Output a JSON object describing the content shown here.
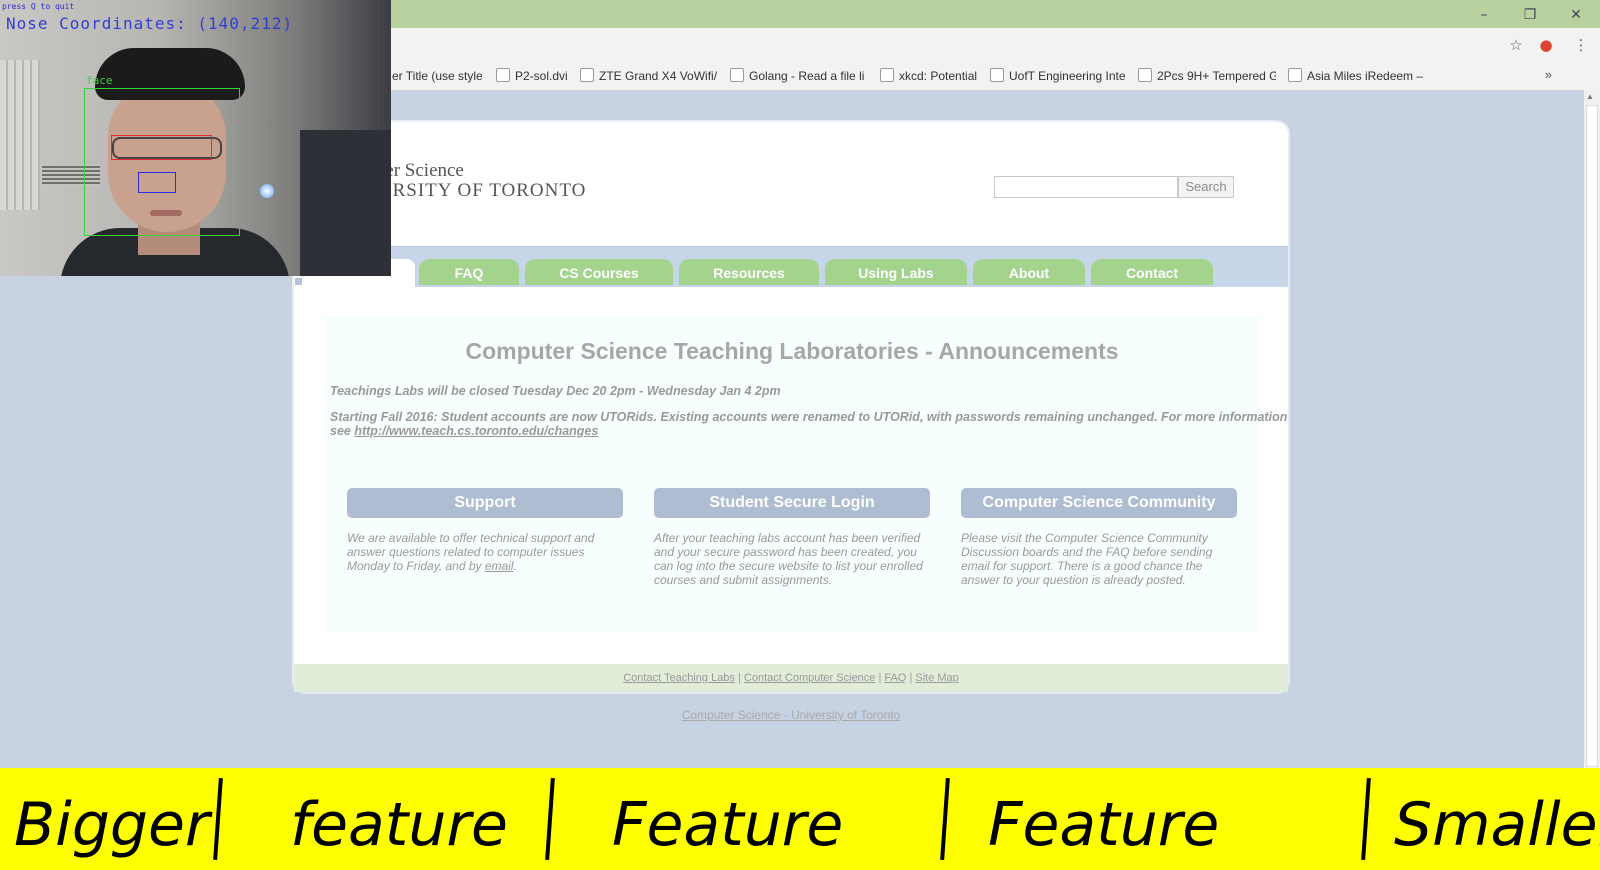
{
  "browser": {
    "window_controls": [
      "–",
      "❐",
      "✕"
    ],
    "toolbar_icons": [
      "star-icon",
      "extension-icon",
      "menu-icon"
    ],
    "bookmarks": [
      "er Title (use style:",
      "P2-sol.dvi",
      "ZTE Grand X4 VoWifi/",
      "Golang - Read a file li",
      "xkcd: Potential",
      "UofT Engineering Inte",
      "2Pcs 9H+ Tempered G",
      "Asia Miles iRedeem –"
    ],
    "bookmarks_overflow": "»"
  },
  "site": {
    "logo_line1": "ter Science",
    "logo_line2": "ERSITY OF TORONTO",
    "search_button": "Search",
    "nav_tabs": [
      "FAQ",
      "CS Courses",
      "Resources",
      "Using Labs",
      "About",
      "Contact"
    ]
  },
  "announcements": {
    "title": "Computer Science Teaching Laboratories - Announcements",
    "item1": "Teachings Labs will be closed Tuesday Dec 20 2pm - Wednesday Jan 4 2pm",
    "item2_line1": "Starting Fall 2016: Student accounts are now UTORids. Existing accounts were renamed to UTORid, with passwords remaining unchanged. For more information",
    "item2_see": "see",
    "item2_link": "http://www.teach.cs.toronto.edu/changes"
  },
  "columns": [
    {
      "heading": "Support",
      "line1": "We are available to offer technical support and",
      "line2": "answer questions related to computer issues",
      "line3_pre": "Monday to Friday, and by ",
      "line3_link": "email",
      "line3_post": "."
    },
    {
      "heading": "Student Secure Login",
      "line1": "After your teaching labs account has been verified",
      "line2": "and your secure password has been created, you",
      "line3": "can log into the secure website to list your enrolled",
      "line4": "courses and submit assignments."
    },
    {
      "heading": "Computer Science Community",
      "line1": "Please visit the Computer Science Community",
      "line2": "Discussion boards and the FAQ before sending",
      "line3": "email for support. There is a good chance the",
      "line4": "answer to your question is already posted."
    }
  ],
  "footer": {
    "links": [
      "Contact Teaching Labs",
      "Contact Computer Science",
      "FAQ",
      "Site Map"
    ],
    "separator": "|",
    "bottom_link": "Computer Science - University of Toronto"
  },
  "webcam": {
    "quit_hint": "press Q to quit",
    "nose_coordinates": "Nose Coordinates: (140,212)",
    "face_label": "face"
  },
  "banner": {
    "labels": [
      "Bigger",
      "feature",
      "Feature",
      "Feature",
      "Smaller"
    ]
  }
}
